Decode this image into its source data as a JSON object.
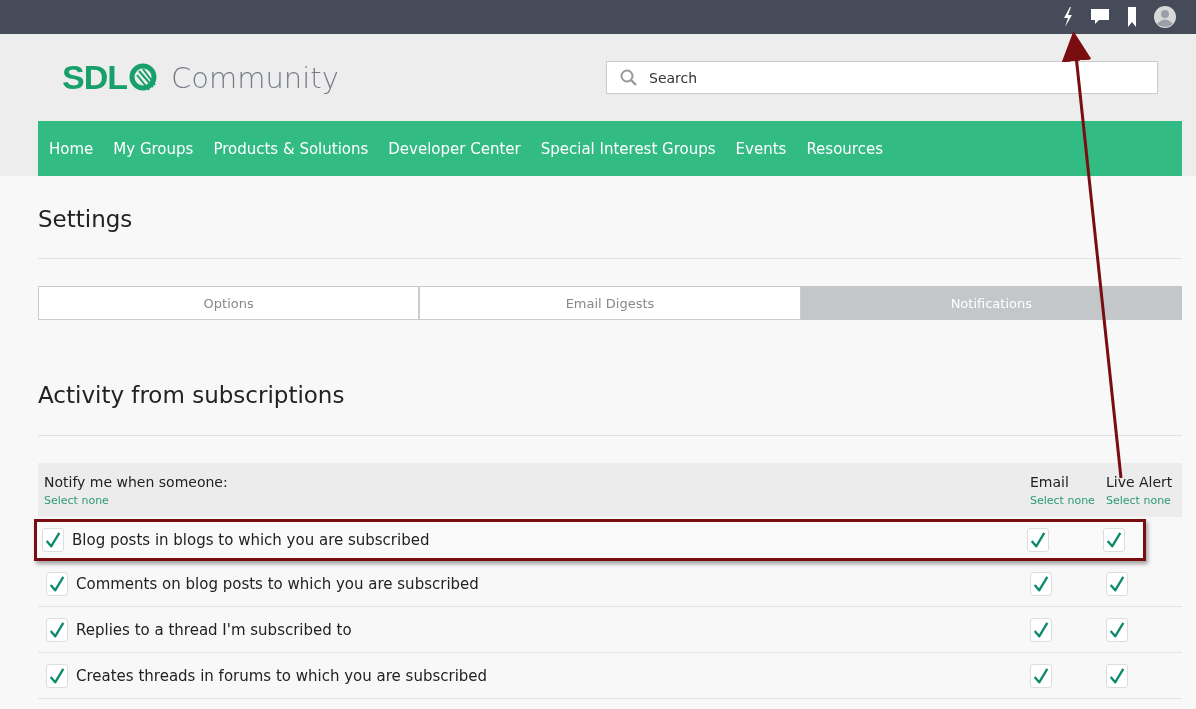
{
  "logo": {
    "brand": "SDL",
    "name": "Community"
  },
  "search": {
    "placeholder": "Search"
  },
  "nav": [
    "Home",
    "My Groups",
    "Products & Solutions",
    "Developer Center",
    "Special Interest Groups",
    "Events",
    "Resources"
  ],
  "page_title": "Settings",
  "tabs": [
    {
      "label": "Options",
      "selected": false
    },
    {
      "label": "Email Digests",
      "selected": false
    },
    {
      "label": "Notifications",
      "selected": true
    }
  ],
  "section_title": "Activity from subscriptions",
  "table": {
    "columns": [
      {
        "label": "Notify me when someone:",
        "action": "Select none"
      },
      {
        "label": "Email",
        "action": "Select none"
      },
      {
        "label": "Live Alert",
        "action": "Select none"
      }
    ],
    "rows": [
      {
        "label": "Blog posts in blogs to which you are subscribed",
        "checked": true,
        "email": true,
        "live_alert": true,
        "highlighted": true
      },
      {
        "label": "Comments on blog posts to which you are subscribed",
        "checked": true,
        "email": true,
        "live_alert": true,
        "highlighted": false
      },
      {
        "label": "Replies to a thread I'm subscribed to",
        "checked": true,
        "email": true,
        "live_alert": true,
        "highlighted": false
      },
      {
        "label": "Creates threads in forums to which you are subscribed",
        "checked": true,
        "email": true,
        "live_alert": true,
        "highlighted": false
      }
    ]
  }
}
